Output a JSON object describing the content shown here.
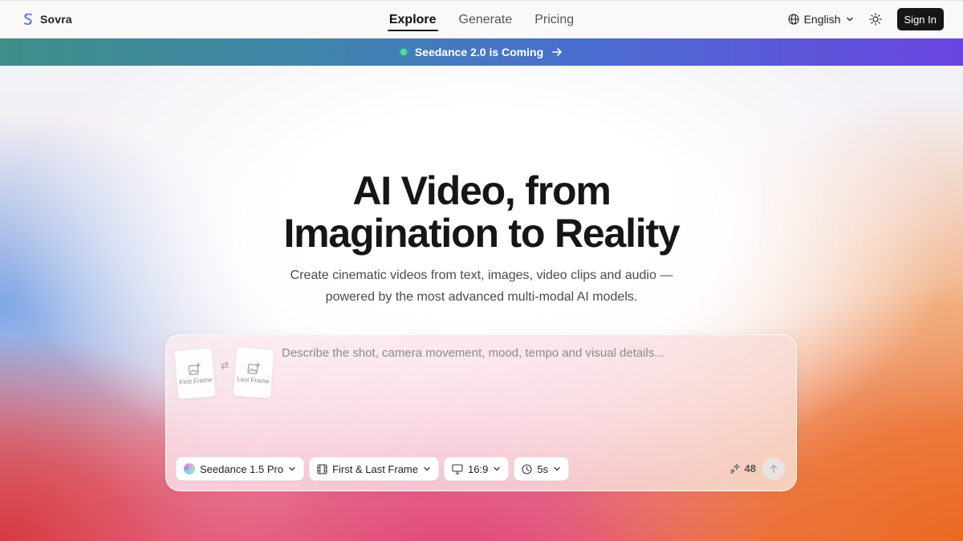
{
  "nav": {
    "brand": "Sovra",
    "tabs": [
      {
        "label": "Explore",
        "active": true
      },
      {
        "label": "Generate",
        "active": false
      },
      {
        "label": "Pricing",
        "active": false
      }
    ],
    "language": "English",
    "language_icon": "globe-icon",
    "theme_icon": "sun-icon",
    "sign_in": "Sign In"
  },
  "banner": {
    "text": "Seedance 2.0 is Coming",
    "icon": "arrow-right-icon",
    "dot_color": "#4be39a"
  },
  "hero": {
    "title_line1": "AI Video, from",
    "title_line2": "Imagination to Reality",
    "subtitle": "Create cinematic videos from text, images, video clips and audio — powered by the most advanced multi-modal AI models."
  },
  "prompt": {
    "placeholder": "Describe the shot, camera movement, mood, tempo and visual details...",
    "first_frame": "First Frame",
    "last_frame": "Last Frame",
    "model": "Seedance 1.5 Pro",
    "mode": "First & Last Frame",
    "aspect_ratio": "16:9",
    "duration": "5s",
    "credits": "48"
  },
  "colors": {
    "accent_dark": "#161616",
    "banner_start": "#3d8f89",
    "banner_end": "#6a44e0"
  }
}
